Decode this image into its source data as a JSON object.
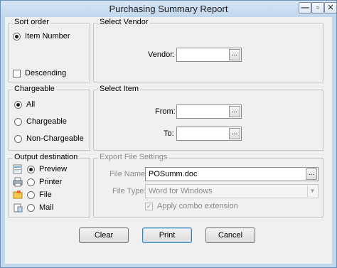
{
  "window": {
    "title": "Purchasing Summary Report",
    "minimize_glyph": "—",
    "maximize_glyph": "▫",
    "close_glyph": "✕"
  },
  "sort_order": {
    "legend": "Sort order",
    "item_number_label": "Item Number",
    "item_number_selected": true,
    "descending_label": "Descending",
    "descending_checked": false
  },
  "select_vendor": {
    "legend": "Select Vendor",
    "vendor_label": "Vendor:",
    "vendor_value": "",
    "browse_glyph": "..."
  },
  "chargeable": {
    "legend": "Chargeable",
    "options": [
      {
        "label": "All",
        "selected": true
      },
      {
        "label": "Chargeable",
        "selected": false
      },
      {
        "label": "Non-Chargeable",
        "selected": false
      }
    ]
  },
  "select_item": {
    "legend": "Select Item",
    "from_label": "From:",
    "from_value": "",
    "to_label": "To:",
    "to_value": "",
    "browse_glyph": "..."
  },
  "output_destination": {
    "legend": "Output destination",
    "options": [
      {
        "label": "Preview",
        "selected": true,
        "icon": "preview-icon"
      },
      {
        "label": "Printer",
        "selected": false,
        "icon": "printer-icon"
      },
      {
        "label": "File",
        "selected": false,
        "icon": "folder-icon"
      },
      {
        "label": "Mail",
        "selected": false,
        "icon": "mail-icon"
      }
    ]
  },
  "export_settings": {
    "legend": "Export  File Settings",
    "file_name_label": "File Name:",
    "file_name_value": "POSumm.doc",
    "file_type_label": "File Type:",
    "file_type_value": "Word for Windows",
    "apply_combo_label": "Apply combo extension",
    "apply_combo_checked": true,
    "browse_glyph": "..."
  },
  "buttons": {
    "clear": "Clear",
    "print": "Print",
    "cancel": "Cancel"
  },
  "colors": {
    "titlebar": "#c2d8ee",
    "client": "#f0f0f0",
    "disabled_text": "#8a8a8a"
  }
}
